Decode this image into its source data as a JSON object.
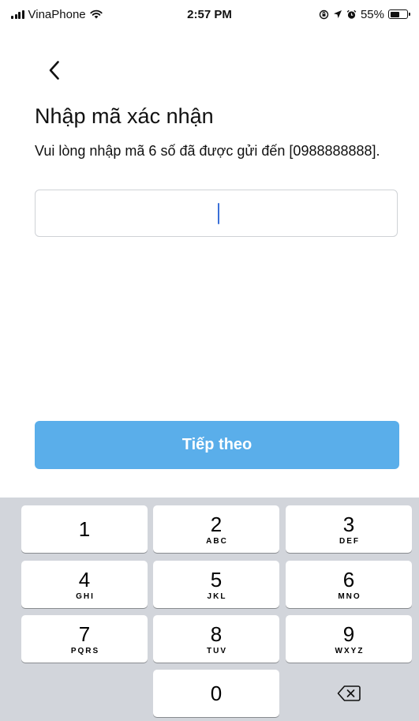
{
  "status_bar": {
    "carrier": "VinaPhone",
    "time": "2:57 PM",
    "battery_percent": "55%",
    "battery_level": 0.55,
    "icons": [
      "signal-icon",
      "wifi-icon",
      "lock-rotation-icon",
      "location-icon",
      "alarm-icon",
      "battery-icon"
    ]
  },
  "header": {
    "back_icon": "chevron-left-icon"
  },
  "main": {
    "title": "Nhập mã xác nhận",
    "subtitle": "Vui lòng nhập mã 6 số đã được gửi đến [0988888888].",
    "code_input": {
      "value": "",
      "placeholder": ""
    },
    "continue_label": "Tiếp theo"
  },
  "colors": {
    "accent": "#5aaeea",
    "caret": "#3a6fd8",
    "keyboard_bg": "#d2d5db"
  },
  "keyboard": {
    "keys": [
      {
        "digit": "1",
        "letters": ""
      },
      {
        "digit": "2",
        "letters": "ABC"
      },
      {
        "digit": "3",
        "letters": "DEF"
      },
      {
        "digit": "4",
        "letters": "GHI"
      },
      {
        "digit": "5",
        "letters": "JKL"
      },
      {
        "digit": "6",
        "letters": "MNO"
      },
      {
        "digit": "7",
        "letters": "PQRS"
      },
      {
        "digit": "8",
        "letters": "TUV"
      },
      {
        "digit": "9",
        "letters": "WXYZ"
      },
      {
        "digit": "0",
        "letters": ""
      }
    ],
    "delete_icon": "backspace-icon"
  }
}
